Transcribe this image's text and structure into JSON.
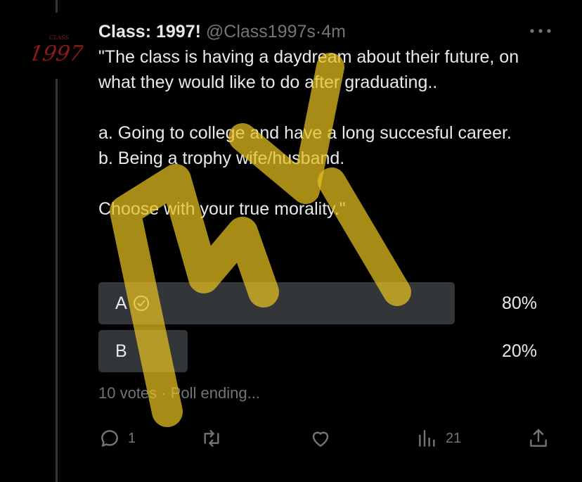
{
  "author": {
    "name": "Class: 1997!",
    "handle": "@Class1997s",
    "separator": "·",
    "time": "4m",
    "avatar_text": "1997",
    "avatar_small_text": "CLASS"
  },
  "tweet": {
    "text": "\"The class is having a daydream about their future, on what they would like to do after graduating..\n\na. Going to college and have a long succesful career.\nb. Being a trophy wife/husband.\n\nChoose with your true morality.\""
  },
  "poll": {
    "options": [
      {
        "label": "A",
        "percent_text": "80%",
        "percent": 80,
        "selected": true
      },
      {
        "label": "B",
        "percent_text": "20%",
        "percent": 20,
        "selected": false
      }
    ],
    "meta": "10 votes · Poll ending..."
  },
  "actions": {
    "reply_count": "1",
    "retweet_count": "",
    "like_count": "",
    "views_count": "21"
  },
  "watermark_text": "MY",
  "colors": {
    "background": "#000000",
    "text": "#e7e9ea",
    "muted": "#71767b",
    "poll_fill": "#333639",
    "watermark": "#e8c020",
    "avatar_red": "#8b1a1a"
  }
}
